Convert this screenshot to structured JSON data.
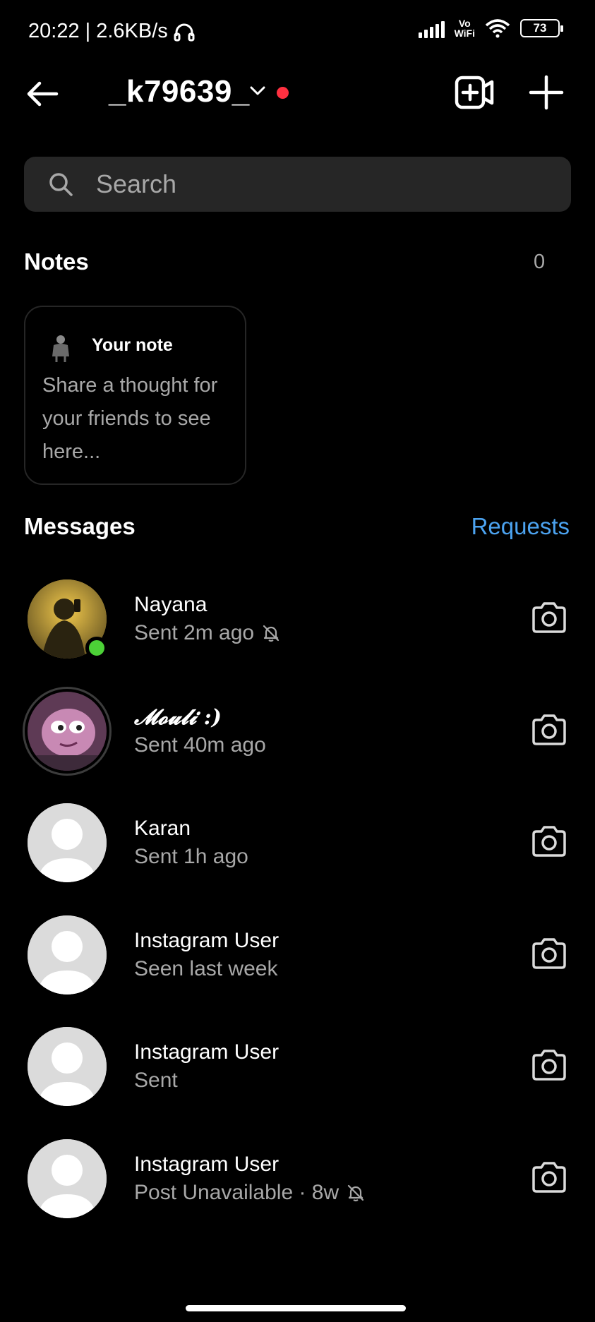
{
  "status_bar": {
    "time_speed": "20:22 | 2.6KB/s",
    "vowifi_top": "Vo",
    "vowifi_bottom": "WiFi",
    "battery": "73"
  },
  "header": {
    "username": "_k79639_"
  },
  "search": {
    "placeholder": "Search"
  },
  "notes": {
    "title": "Notes",
    "count": "0",
    "card_label": "Your note",
    "card_text": "Share a thought for your friends to see here..."
  },
  "messages": {
    "title": "Messages",
    "requests_label": "Requests",
    "items": [
      {
        "name": "Nayana",
        "status": "Sent 2m ago",
        "muted": true,
        "online": true,
        "avatar": "photo"
      },
      {
        "name": "𝓜𝓸𝓾𝓵𝓲 :)",
        "status": "Sent 40m ago",
        "muted": false,
        "online": false,
        "avatar": "cartoon"
      },
      {
        "name": "Karan",
        "status": "Sent 1h ago",
        "muted": false,
        "online": false,
        "avatar": "default"
      },
      {
        "name": "Instagram User",
        "status": "Seen last week",
        "muted": false,
        "online": false,
        "avatar": "default"
      },
      {
        "name": "Instagram User",
        "status": "Sent",
        "muted": false,
        "online": false,
        "avatar": "default"
      },
      {
        "name": "Instagram User",
        "status": "Post Unavailable · 8w",
        "muted": true,
        "online": false,
        "avatar": "default"
      }
    ]
  },
  "colors": {
    "background": "#000000",
    "accent_blue": "#4ca3f0",
    "online_green": "#4cd137",
    "notification_red": "#ff3040",
    "search_bg": "#262626"
  }
}
